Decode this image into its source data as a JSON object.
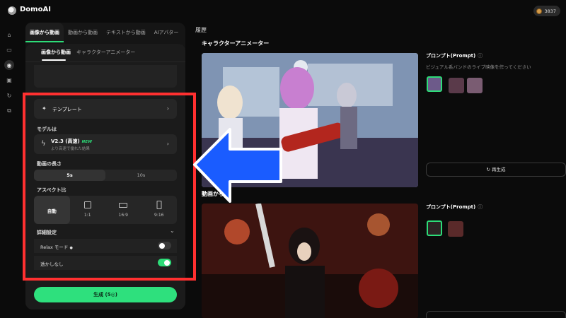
{
  "app": {
    "title": "DomoAI",
    "credits": "3837"
  },
  "rail": {
    "icons": [
      "home-icon",
      "box-icon",
      "eye-icon",
      "image-icon",
      "refresh-icon",
      "layers-icon"
    ]
  },
  "mode_tabs": [
    "画像から動画",
    "動画から動画",
    "テキストから動画",
    "AIアバター"
  ],
  "sub_tabs": [
    "画像から動画",
    "キャラクターアニメーター"
  ],
  "template": {
    "label": "テンプレート"
  },
  "model": {
    "section_label": "モデルは",
    "name": "V2.3 (高速)",
    "badge": "NEW",
    "desc": "より高速で優れた結果"
  },
  "duration": {
    "label": "動画の長さ",
    "options": [
      "5s",
      "10s"
    ],
    "selected": "5s"
  },
  "aspect": {
    "label": "アスペクト比",
    "options": [
      "自動",
      "1:1",
      "16:9",
      "9:16"
    ],
    "selected": "自動"
  },
  "advanced": {
    "label": "詳細設定",
    "relax_label": "Relax モード",
    "relax_on": false,
    "watermark_label": "透かしなし",
    "watermark_on": true
  },
  "generate_label": "生成 (5◎)",
  "history": {
    "title": "履歴",
    "items": [
      {
        "section": "キャラクターアニメーター",
        "prompt_label": "プロンプト(Prompt)",
        "prompt_text": "ビジュアル系バンドのライブ映像を作ってください",
        "regen_label": "再生成"
      },
      {
        "section": "動画から",
        "prompt_label": "プロンプト(Prompt)",
        "prompt_text": "",
        "regen_label": ""
      }
    ]
  },
  "colors": {
    "accent": "#2ddc78",
    "highlight_box": "#ff3030",
    "arrow": "#1a5cff"
  }
}
